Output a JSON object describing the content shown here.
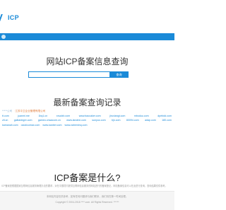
{
  "header": {
    "logo_text": "ICP"
  },
  "hero": {
    "title": "网站ICP备案信息查询",
    "search_placeholder": "",
    "search_button": "查询"
  },
  "recent": {
    "title": "最新备案查询记录",
    "rows": [
      [
        "*****公司",
        "江苏中卫企业管理有限公司",
        "",
        "",
        "",
        "",
        "",
        "",
        ""
      ],
      [
        "tt.com",
        "juanmi.me",
        "1bq1.cn",
        "xnudxb.com",
        "www.baocaker.com",
        "jiruxiangt.com",
        "mboduu.com",
        "dpebdd.com"
      ],
      [
        "zlt.cn",
        "galbanbgre.com",
        "gameo.cnwacom.cn",
        "www.landexi.com",
        "sunyuo.com",
        "bjn.com",
        "80094.com",
        "adap.com",
        "180.com"
      ],
      [
        "kamanah.com",
        "ozukicumax.com",
        "www.kanber.com",
        "www.zaheminq.com",
        "",
        "",
        "",
        "",
        ""
      ]
    ]
  },
  "icp": {
    "title": "ICP备案是什么?",
    "desc": "ICP备案是根据国家互联网信息服务管理办法的要求，对在中国境内提供互联网信息服务的网站进行的备案登记。网站备案信息可以在此进行查询，查询结果仅供参考。"
  },
  "footer": {
    "note": "本网站内容仅供参考，如有任何问题请与我们联系，我们将在第一时间处理。",
    "copyright": "Copyright © 2004-2018 ****.com. All Rights Reserved.  ******"
  }
}
